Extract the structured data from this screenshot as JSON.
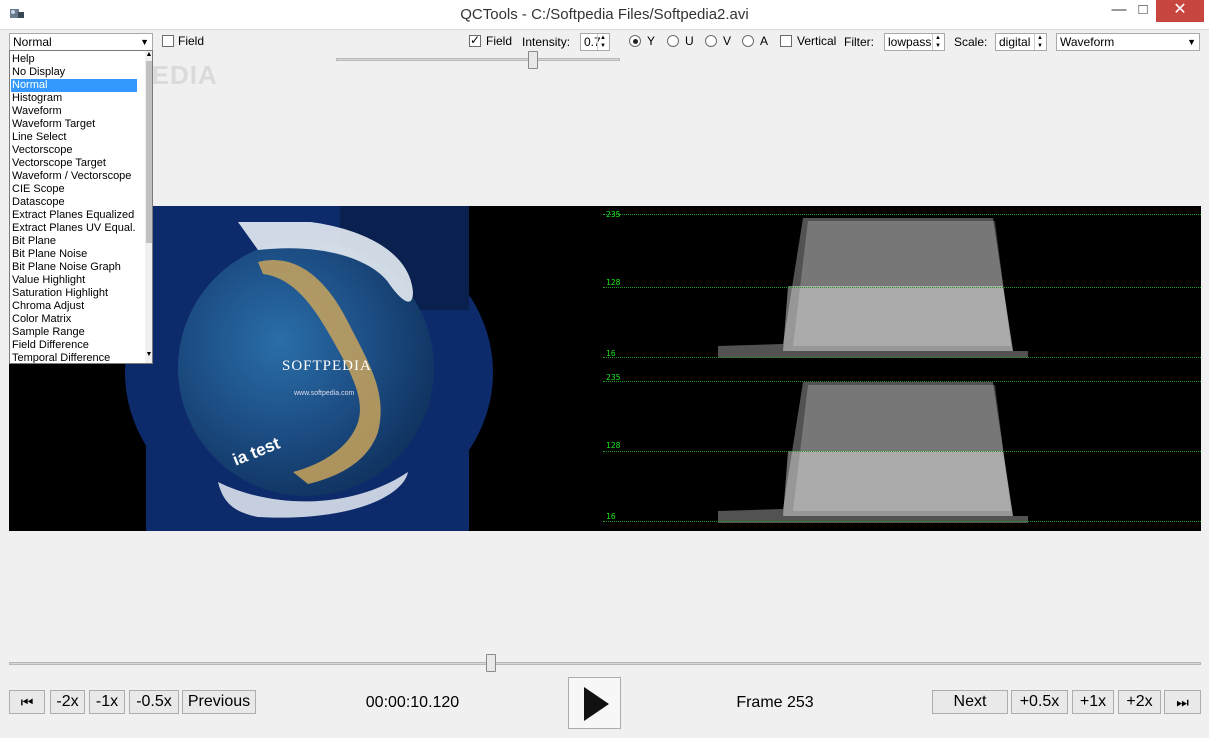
{
  "window": {
    "title": "QCTools - C:/Softpedia Files/Softpedia2.avi",
    "minimize": "—",
    "maximize": "□",
    "close": "✕"
  },
  "left_panel": {
    "filter_value": "Normal",
    "field_label": "Field",
    "field_checked": false,
    "filter_options": [
      "Help",
      "No Display",
      "Normal",
      "Histogram",
      "Waveform",
      "Waveform Target",
      "Line Select",
      "Vectorscope",
      "Vectorscope Target",
      "Waveform / Vectorscope",
      "CIE Scope",
      "Datascope",
      "Extract Planes Equalized",
      "Extract Planes UV Equal.",
      "Bit Plane",
      "Bit Plane Noise",
      "Bit Plane Noise Graph",
      "Value Highlight",
      "Saturation Highlight",
      "Chroma Adjust",
      "Color Matrix",
      "Sample Range",
      "Field Difference",
      "Temporal Difference"
    ],
    "selected_option": "Normal"
  },
  "right_panel": {
    "field_label": "Field",
    "field_checked": true,
    "intensity_label": "Intensity:",
    "intensity_value": "0.7",
    "channels": [
      "Y",
      "U",
      "V",
      "A"
    ],
    "selected_channel": "Y",
    "vertical_label": "Vertical",
    "vertical_checked": false,
    "filter_label": "Filter:",
    "filter_value": "lowpass",
    "scale_label": "Scale:",
    "scale_value": "digital",
    "view_value": "Waveform"
  },
  "video": {
    "overlay_title": "SOFTPEDIA",
    "overlay_url": "www.softpedia.com",
    "overlay_caption": "ia test",
    "watermark": "SOFTPEDIA"
  },
  "waveform": {
    "levels": [
      "235",
      "128",
      "16"
    ],
    "line_color": "#1e9e1e",
    "label_color": "#19e619"
  },
  "controls": {
    "frame_back": "⏮",
    "speed_buttons_left": [
      "-2x",
      "-1x",
      "-0.5x",
      "Previous"
    ],
    "timecode": "00:00:10.120",
    "play": "▶",
    "frame_label": "Frame 253",
    "speed_buttons_right": [
      "Next",
      "+0.5x",
      "+1x",
      "+2x"
    ],
    "frame_forward": "⏭"
  },
  "colors": {
    "selection": "#3399ff",
    "close_button": "#c7463f",
    "video_background": "#0d2a6b"
  }
}
